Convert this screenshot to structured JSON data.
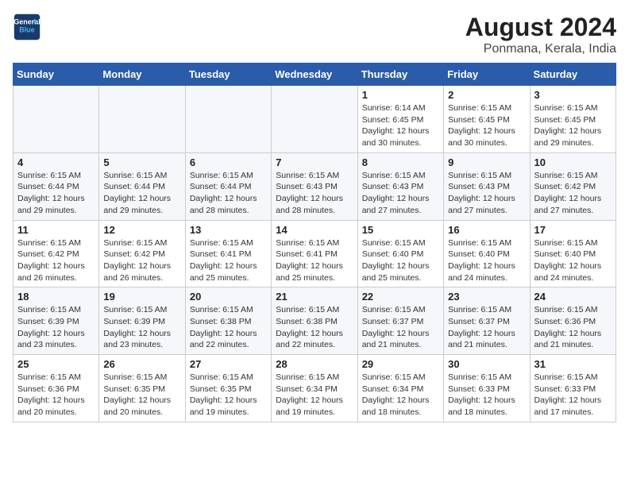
{
  "header": {
    "logo_line1": "General",
    "logo_line2": "Blue",
    "title": "August 2024",
    "subtitle": "Ponmana, Kerala, India"
  },
  "weekdays": [
    "Sunday",
    "Monday",
    "Tuesday",
    "Wednesday",
    "Thursday",
    "Friday",
    "Saturday"
  ],
  "weeks": [
    [
      {
        "day": "",
        "info": ""
      },
      {
        "day": "",
        "info": ""
      },
      {
        "day": "",
        "info": ""
      },
      {
        "day": "",
        "info": ""
      },
      {
        "day": "1",
        "info": "Sunrise: 6:14 AM\nSunset: 6:45 PM\nDaylight: 12 hours\nand 30 minutes."
      },
      {
        "day": "2",
        "info": "Sunrise: 6:15 AM\nSunset: 6:45 PM\nDaylight: 12 hours\nand 30 minutes."
      },
      {
        "day": "3",
        "info": "Sunrise: 6:15 AM\nSunset: 6:45 PM\nDaylight: 12 hours\nand 29 minutes."
      }
    ],
    [
      {
        "day": "4",
        "info": "Sunrise: 6:15 AM\nSunset: 6:44 PM\nDaylight: 12 hours\nand 29 minutes."
      },
      {
        "day": "5",
        "info": "Sunrise: 6:15 AM\nSunset: 6:44 PM\nDaylight: 12 hours\nand 29 minutes."
      },
      {
        "day": "6",
        "info": "Sunrise: 6:15 AM\nSunset: 6:44 PM\nDaylight: 12 hours\nand 28 minutes."
      },
      {
        "day": "7",
        "info": "Sunrise: 6:15 AM\nSunset: 6:43 PM\nDaylight: 12 hours\nand 28 minutes."
      },
      {
        "day": "8",
        "info": "Sunrise: 6:15 AM\nSunset: 6:43 PM\nDaylight: 12 hours\nand 27 minutes."
      },
      {
        "day": "9",
        "info": "Sunrise: 6:15 AM\nSunset: 6:43 PM\nDaylight: 12 hours\nand 27 minutes."
      },
      {
        "day": "10",
        "info": "Sunrise: 6:15 AM\nSunset: 6:42 PM\nDaylight: 12 hours\nand 27 minutes."
      }
    ],
    [
      {
        "day": "11",
        "info": "Sunrise: 6:15 AM\nSunset: 6:42 PM\nDaylight: 12 hours\nand 26 minutes."
      },
      {
        "day": "12",
        "info": "Sunrise: 6:15 AM\nSunset: 6:42 PM\nDaylight: 12 hours\nand 26 minutes."
      },
      {
        "day": "13",
        "info": "Sunrise: 6:15 AM\nSunset: 6:41 PM\nDaylight: 12 hours\nand 25 minutes."
      },
      {
        "day": "14",
        "info": "Sunrise: 6:15 AM\nSunset: 6:41 PM\nDaylight: 12 hours\nand 25 minutes."
      },
      {
        "day": "15",
        "info": "Sunrise: 6:15 AM\nSunset: 6:40 PM\nDaylight: 12 hours\nand 25 minutes."
      },
      {
        "day": "16",
        "info": "Sunrise: 6:15 AM\nSunset: 6:40 PM\nDaylight: 12 hours\nand 24 minutes."
      },
      {
        "day": "17",
        "info": "Sunrise: 6:15 AM\nSunset: 6:40 PM\nDaylight: 12 hours\nand 24 minutes."
      }
    ],
    [
      {
        "day": "18",
        "info": "Sunrise: 6:15 AM\nSunset: 6:39 PM\nDaylight: 12 hours\nand 23 minutes."
      },
      {
        "day": "19",
        "info": "Sunrise: 6:15 AM\nSunset: 6:39 PM\nDaylight: 12 hours\nand 23 minutes."
      },
      {
        "day": "20",
        "info": "Sunrise: 6:15 AM\nSunset: 6:38 PM\nDaylight: 12 hours\nand 22 minutes."
      },
      {
        "day": "21",
        "info": "Sunrise: 6:15 AM\nSunset: 6:38 PM\nDaylight: 12 hours\nand 22 minutes."
      },
      {
        "day": "22",
        "info": "Sunrise: 6:15 AM\nSunset: 6:37 PM\nDaylight: 12 hours\nand 21 minutes."
      },
      {
        "day": "23",
        "info": "Sunrise: 6:15 AM\nSunset: 6:37 PM\nDaylight: 12 hours\nand 21 minutes."
      },
      {
        "day": "24",
        "info": "Sunrise: 6:15 AM\nSunset: 6:36 PM\nDaylight: 12 hours\nand 21 minutes."
      }
    ],
    [
      {
        "day": "25",
        "info": "Sunrise: 6:15 AM\nSunset: 6:36 PM\nDaylight: 12 hours\nand 20 minutes."
      },
      {
        "day": "26",
        "info": "Sunrise: 6:15 AM\nSunset: 6:35 PM\nDaylight: 12 hours\nand 20 minutes."
      },
      {
        "day": "27",
        "info": "Sunrise: 6:15 AM\nSunset: 6:35 PM\nDaylight: 12 hours\nand 19 minutes."
      },
      {
        "day": "28",
        "info": "Sunrise: 6:15 AM\nSunset: 6:34 PM\nDaylight: 12 hours\nand 19 minutes."
      },
      {
        "day": "29",
        "info": "Sunrise: 6:15 AM\nSunset: 6:34 PM\nDaylight: 12 hours\nand 18 minutes."
      },
      {
        "day": "30",
        "info": "Sunrise: 6:15 AM\nSunset: 6:33 PM\nDaylight: 12 hours\nand 18 minutes."
      },
      {
        "day": "31",
        "info": "Sunrise: 6:15 AM\nSunset: 6:33 PM\nDaylight: 12 hours\nand 17 minutes."
      }
    ]
  ]
}
